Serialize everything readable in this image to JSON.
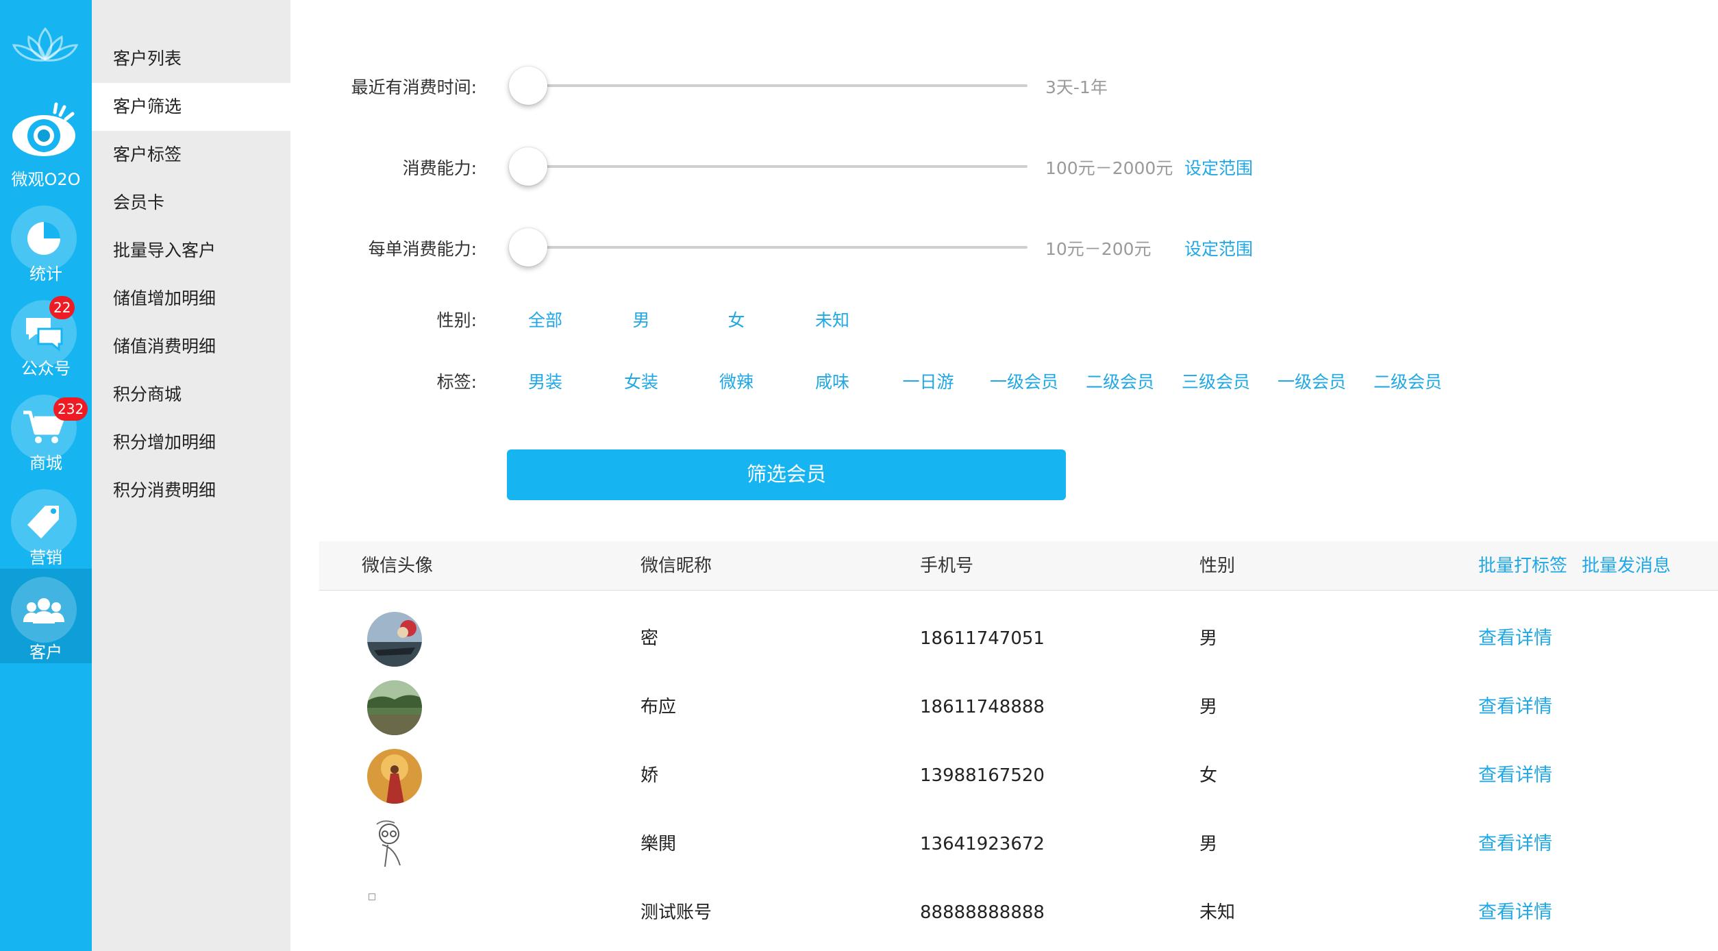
{
  "rail": {
    "items": [
      {
        "label": "微观O2O",
        "icon": "eye-icon"
      },
      {
        "label": "统计",
        "icon": "pie-chart-icon"
      },
      {
        "label": "公众号",
        "icon": "chat-bubbles-icon",
        "badge": "22"
      },
      {
        "label": "商城",
        "icon": "shopping-cart-icon",
        "badge": "232"
      },
      {
        "label": "营销",
        "icon": "price-tag-icon"
      },
      {
        "label": "客户",
        "icon": "customers-icon"
      }
    ],
    "active_index": 5
  },
  "sidebar": {
    "items": [
      {
        "label": "客户列表"
      },
      {
        "label": "客户筛选"
      },
      {
        "label": "客户标签"
      },
      {
        "label": "会员卡"
      },
      {
        "label": "批量导入客户"
      },
      {
        "label": "储值增加明细"
      },
      {
        "label": "储值消费明细"
      },
      {
        "label": "积分商城"
      },
      {
        "label": "积分增加明细"
      },
      {
        "label": "积分消费明细"
      }
    ],
    "active_index": 1
  },
  "filters": {
    "recent_purchase": {
      "label": "最近有消费时间:",
      "range": "3天-1年",
      "level": 0
    },
    "spending_power": {
      "label": "消费能力:",
      "range": "100元－2000元",
      "action": "设定范围",
      "level": 0
    },
    "per_order_power": {
      "label": "每单消费能力:",
      "range": "10元－200元",
      "action": "设定范围",
      "level": 0
    },
    "gender": {
      "label": "性别:",
      "options": [
        "全部",
        "男",
        "女",
        "未知"
      ]
    },
    "tags": {
      "label": "标签:",
      "options": [
        "男装",
        "女装",
        "微辣",
        "咸味",
        "一日游",
        "一级会员",
        "二级会员",
        "三级会员",
        "一级会员",
        "二级会员"
      ]
    },
    "submit_label": "筛选会员"
  },
  "table": {
    "headers": {
      "avatar": "微信头像",
      "nickname": "微信昵称",
      "phone": "手机号",
      "gender": "性别"
    },
    "batch_tag_label": "批量打标签",
    "batch_message_label": "批量发消息",
    "detail_label": "查看详情",
    "rows": [
      {
        "nickname": "密",
        "phone": "18611747051",
        "gender": "男"
      },
      {
        "nickname": "布应",
        "phone": "18611748888",
        "gender": "男"
      },
      {
        "nickname": "娇",
        "phone": "13988167520",
        "gender": "女"
      },
      {
        "nickname": "樂閧",
        "phone": "13641923672",
        "gender": "男"
      },
      {
        "nickname": "测试账号",
        "phone": "88888888888",
        "gender": "未知"
      }
    ]
  },
  "colors": {
    "accent": "#16b5f1",
    "link": "#20a8e6",
    "badge": "#ee1b24",
    "sidebar_bg": "#ebebeb"
  }
}
